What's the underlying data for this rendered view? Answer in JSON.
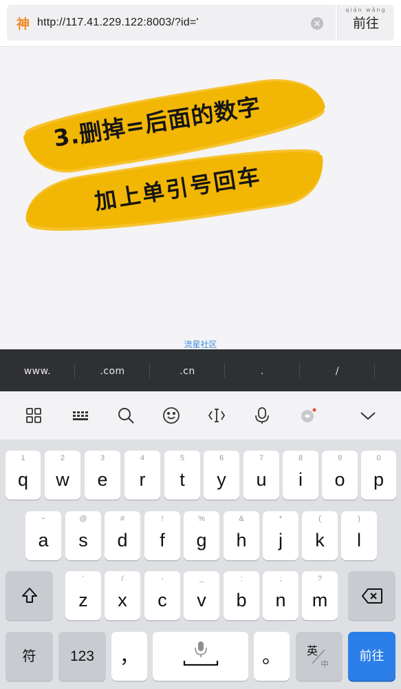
{
  "address_bar": {
    "logo_char": "神",
    "url": "http://117.41.229.122:8003/?id='",
    "go_label": "前往",
    "go_ruby": "qián wǎng"
  },
  "content": {
    "line1": "3.删掉=后面的数字",
    "line2": "加上单引号回车",
    "watermark": "流星社区",
    "brush_color": "#f2b705"
  },
  "suggestions": [
    "www.",
    ".com",
    ".cn",
    ".",
    "/",
    ""
  ],
  "toolbar": {
    "icons": [
      "grid-icon",
      "keyboard-icon",
      "search-icon",
      "emoji-icon",
      "text-cursor-icon",
      "microphone-icon",
      "voice-toggle-icon",
      "collapse-chevron-icon"
    ]
  },
  "keyboard": {
    "row1": [
      {
        "main": "q",
        "sub": "1"
      },
      {
        "main": "w",
        "sub": "2"
      },
      {
        "main": "e",
        "sub": "3"
      },
      {
        "main": "r",
        "sub": "4"
      },
      {
        "main": "t",
        "sub": "5"
      },
      {
        "main": "y",
        "sub": "6"
      },
      {
        "main": "u",
        "sub": "7"
      },
      {
        "main": "i",
        "sub": "8"
      },
      {
        "main": "o",
        "sub": "9"
      },
      {
        "main": "p",
        "sub": "0"
      }
    ],
    "row2": [
      {
        "main": "a",
        "sub": "~"
      },
      {
        "main": "s",
        "sub": "@"
      },
      {
        "main": "d",
        "sub": "#"
      },
      {
        "main": "f",
        "sub": "!"
      },
      {
        "main": "g",
        "sub": "%"
      },
      {
        "main": "h",
        "sub": "&"
      },
      {
        "main": "j",
        "sub": "*"
      },
      {
        "main": "k",
        "sub": "("
      },
      {
        "main": "l",
        "sub": ")"
      }
    ],
    "row3": [
      {
        "main": "z",
        "sub": "'"
      },
      {
        "main": "x",
        "sub": "/"
      },
      {
        "main": "c",
        "sub": "-"
      },
      {
        "main": "v",
        "sub": "_"
      },
      {
        "main": "b",
        "sub": ":"
      },
      {
        "main": "n",
        "sub": ";"
      },
      {
        "main": "m",
        "sub": "?"
      }
    ],
    "symbols_label": "符",
    "numbers_label": "123",
    "comma_label": "，",
    "period_label": "。",
    "lang_top": "英",
    "lang_bottom": "中",
    "enter_label": "前往",
    "enter_color": "#2c7ee8"
  }
}
